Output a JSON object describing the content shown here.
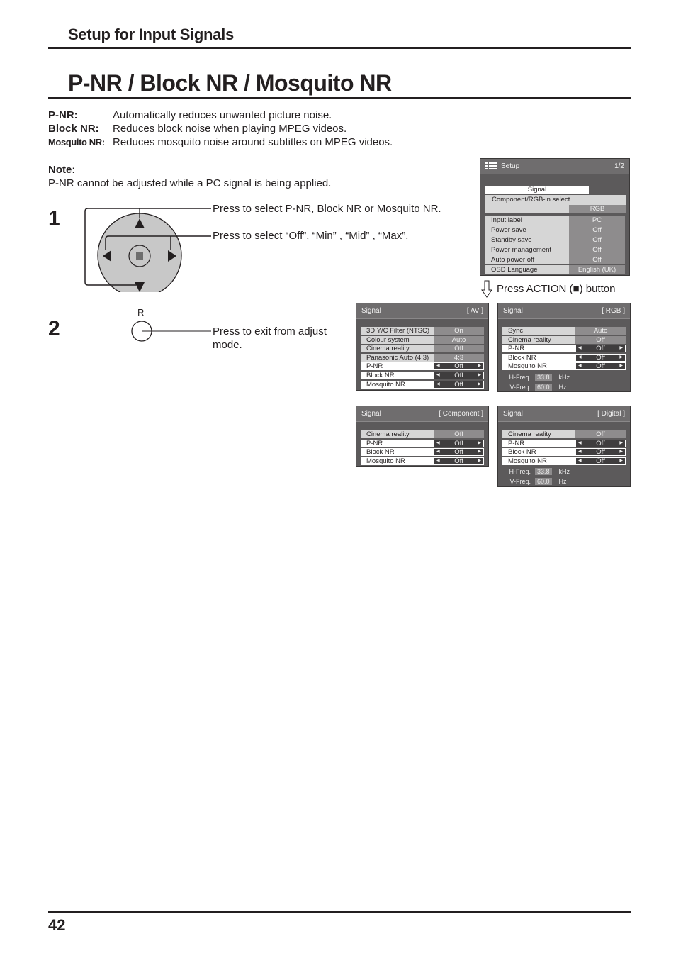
{
  "header": {
    "section_title": "Setup for Input Signals",
    "page_title": "P-NR / Block NR / Mosquito NR"
  },
  "definitions": [
    {
      "term": "P-NR:",
      "text": "Automatically reduces unwanted picture noise."
    },
    {
      "term": "Block NR:",
      "text": "Reduces block noise when playing MPEG videos."
    },
    {
      "term": "Mosquito NR:",
      "text": "Reduces mosquito noise around subtitles on MPEG videos."
    }
  ],
  "note": {
    "label": "Note:",
    "text": "P-NR cannot be adjusted while a PC signal is being applied."
  },
  "steps": [
    {
      "number": "1",
      "instructions": [
        "Press to select P-NR, Block NR or Mosquito NR.",
        "Press to select “Off”, “Min” , “Mid” , “Max”."
      ]
    },
    {
      "number": "2",
      "button_label": "R",
      "instructions": [
        "Press to exit from adjust",
        "mode."
      ]
    }
  ],
  "action_hint": "Press ACTION (■) button",
  "setup_menu": {
    "title": "Setup",
    "page": "1/2",
    "signal_label": "Signal",
    "component_label": "Component/RGB-in select",
    "component_value": "RGB",
    "rows": [
      {
        "label": "Input label",
        "value": "PC"
      },
      {
        "label": "Power save",
        "value": "Off"
      },
      {
        "label": "Standby save",
        "value": "Off"
      },
      {
        "label": "Power management",
        "value": "Off"
      },
      {
        "label": "Auto power off",
        "value": "Off"
      },
      {
        "label": "OSD Language",
        "value": "English (UK)"
      }
    ]
  },
  "signal_menus": {
    "av": {
      "title": "Signal",
      "mode": "[ AV ]",
      "rows": [
        {
          "label": "3D Y/C Filter (NTSC)",
          "value": "On"
        },
        {
          "label": "Colour system",
          "value": "Auto"
        },
        {
          "label": "Cinema reality",
          "value": "Off"
        },
        {
          "label": "Panasonic Auto (4:3)",
          "value": "4:3"
        },
        {
          "label": "P-NR",
          "value": "Off"
        },
        {
          "label": "Block NR",
          "value": "Off"
        },
        {
          "label": "Mosquito NR",
          "value": "Off"
        }
      ]
    },
    "rgb": {
      "title": "Signal",
      "mode": "[ RGB ]",
      "rows": [
        {
          "label": "Sync",
          "value": "Auto"
        },
        {
          "label": "Cinema reality",
          "value": "Off"
        },
        {
          "label": "P-NR",
          "value": "Off"
        },
        {
          "label": "Block NR",
          "value": "Off"
        },
        {
          "label": "Mosquito NR",
          "value": "Off"
        }
      ],
      "h_freq": {
        "label": "H-Freq.",
        "value": "33.8",
        "unit": "kHz"
      },
      "v_freq": {
        "label": "V-Freq.",
        "value": "60.0",
        "unit": "Hz"
      }
    },
    "component": {
      "title": "Signal",
      "mode": "[ Component ]",
      "rows": [
        {
          "label": "Cinema reality",
          "value": "Off"
        },
        {
          "label": "P-NR",
          "value": "Off"
        },
        {
          "label": "Block NR",
          "value": "Off"
        },
        {
          "label": "Mosquito NR",
          "value": "Off"
        }
      ]
    },
    "digital": {
      "title": "Signal",
      "mode": "[ Digital ]",
      "rows": [
        {
          "label": "Cinema reality",
          "value": "Off"
        },
        {
          "label": "P-NR",
          "value": "Off"
        },
        {
          "label": "Block NR",
          "value": "Off"
        },
        {
          "label": "Mosquito NR",
          "value": "Off"
        }
      ],
      "h_freq": {
        "label": "H-Freq.",
        "value": "33.8",
        "unit": "kHz"
      },
      "v_freq": {
        "label": "V-Freq.",
        "value": "60.0",
        "unit": "Hz"
      }
    }
  },
  "footer": {
    "page_number": "42"
  }
}
